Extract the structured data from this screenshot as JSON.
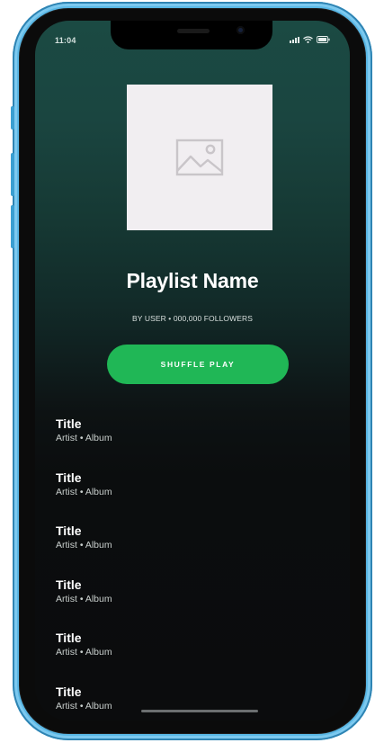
{
  "status_bar": {
    "time": "11:04",
    "icons": [
      "signal-icon",
      "wifi-icon",
      "battery-icon"
    ]
  },
  "playlist": {
    "cover_icon": "image-placeholder-icon",
    "name": "Playlist Name",
    "meta": "BY USER • 000,000 FOLLOWERS",
    "shuffle_label": "SHUFFLE PLAY"
  },
  "tracks": [
    {
      "title": "Title",
      "subtitle": "Artist • Album"
    },
    {
      "title": "Title",
      "subtitle": "Artist • Album"
    },
    {
      "title": "Title",
      "subtitle": "Artist • Album"
    },
    {
      "title": "Title",
      "subtitle": "Artist • Album"
    },
    {
      "title": "Title",
      "subtitle": "Artist • Album"
    },
    {
      "title": "Title",
      "subtitle": "Artist • Album"
    }
  ],
  "colors": {
    "accent": "#20b756",
    "header_gradient_top": "#1b4a43",
    "background": "#0b0c0d",
    "phone_frame": "#5ab8e6"
  }
}
